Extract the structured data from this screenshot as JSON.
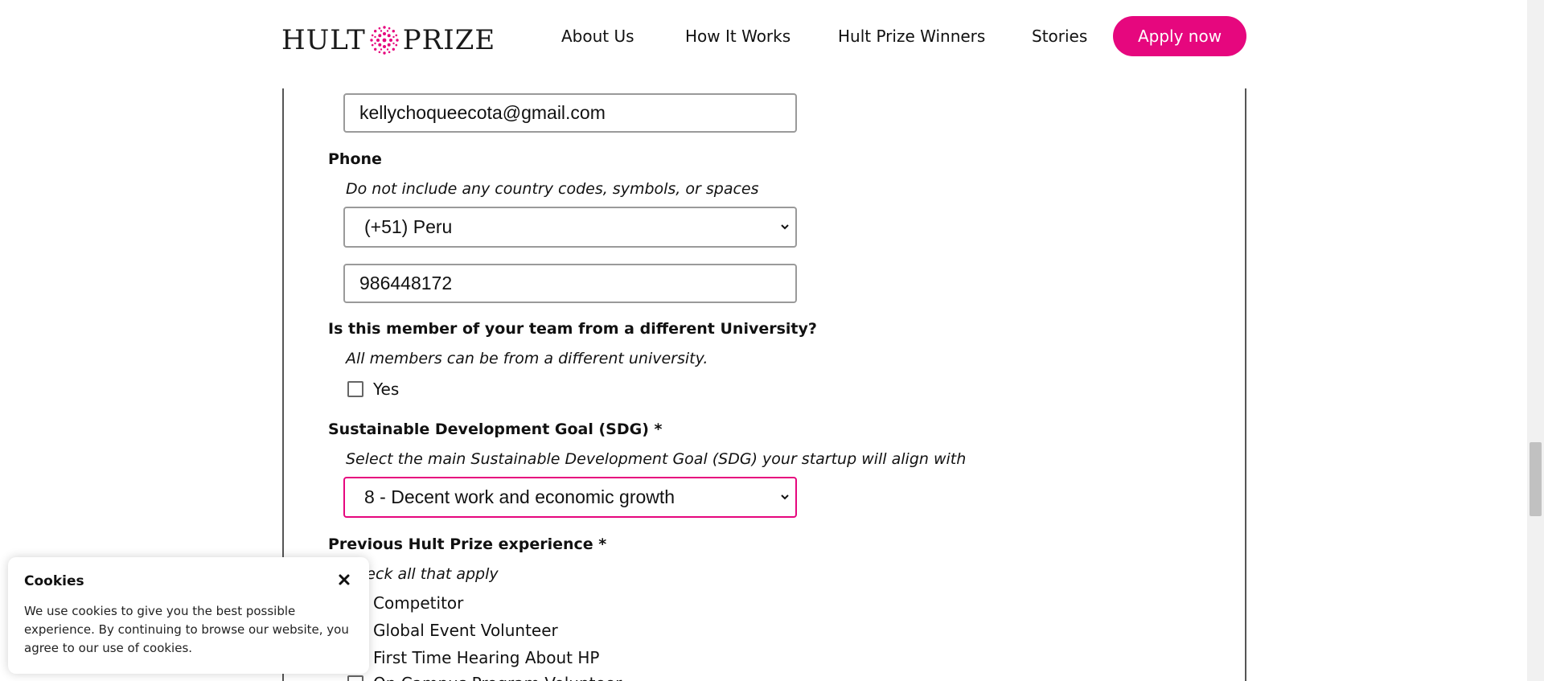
{
  "header": {
    "logo_left": "HULT",
    "logo_right": "PRIZE",
    "nav": [
      "About Us",
      "How It Works",
      "Hult Prize Winners",
      "Stories"
    ],
    "apply_label": "Apply now"
  },
  "form": {
    "email": {
      "value": "kellychoqueecota@gmail.com"
    },
    "phone": {
      "label": "Phone",
      "help": "Do not include any country codes, symbols, or spaces",
      "country_selected": "(+51) Peru",
      "number_value": "986448172"
    },
    "university": {
      "label": "Is this member of your team from a different University?",
      "help": "All members can be from a different university.",
      "yes_label": "Yes",
      "checked": false
    },
    "sdg": {
      "label": "Sustainable Development Goal (SDG) *",
      "help": "Select the main Sustainable Development Goal (SDG) your startup will align with",
      "selected": "8 - Decent work and economic growth"
    },
    "experience": {
      "label": "Previous Hult Prize experience *",
      "help": "Check all that apply",
      "options": [
        "Competitor",
        "Global Event Volunteer",
        "First Time Hearing About HP",
        "On Campus Program Volunteer"
      ]
    }
  },
  "cookie": {
    "title": "Cookies",
    "text": "We use cookies to give you the best possible experience. By continuing to browse our website, you agree to our use of cookies."
  },
  "colors": {
    "accent": "#e6077e",
    "border": "#9a9a9a",
    "frame": "#555555"
  },
  "icons": {
    "logo": "burst-dots-icon",
    "select": "chevron-down-icon",
    "close": "close-icon"
  }
}
